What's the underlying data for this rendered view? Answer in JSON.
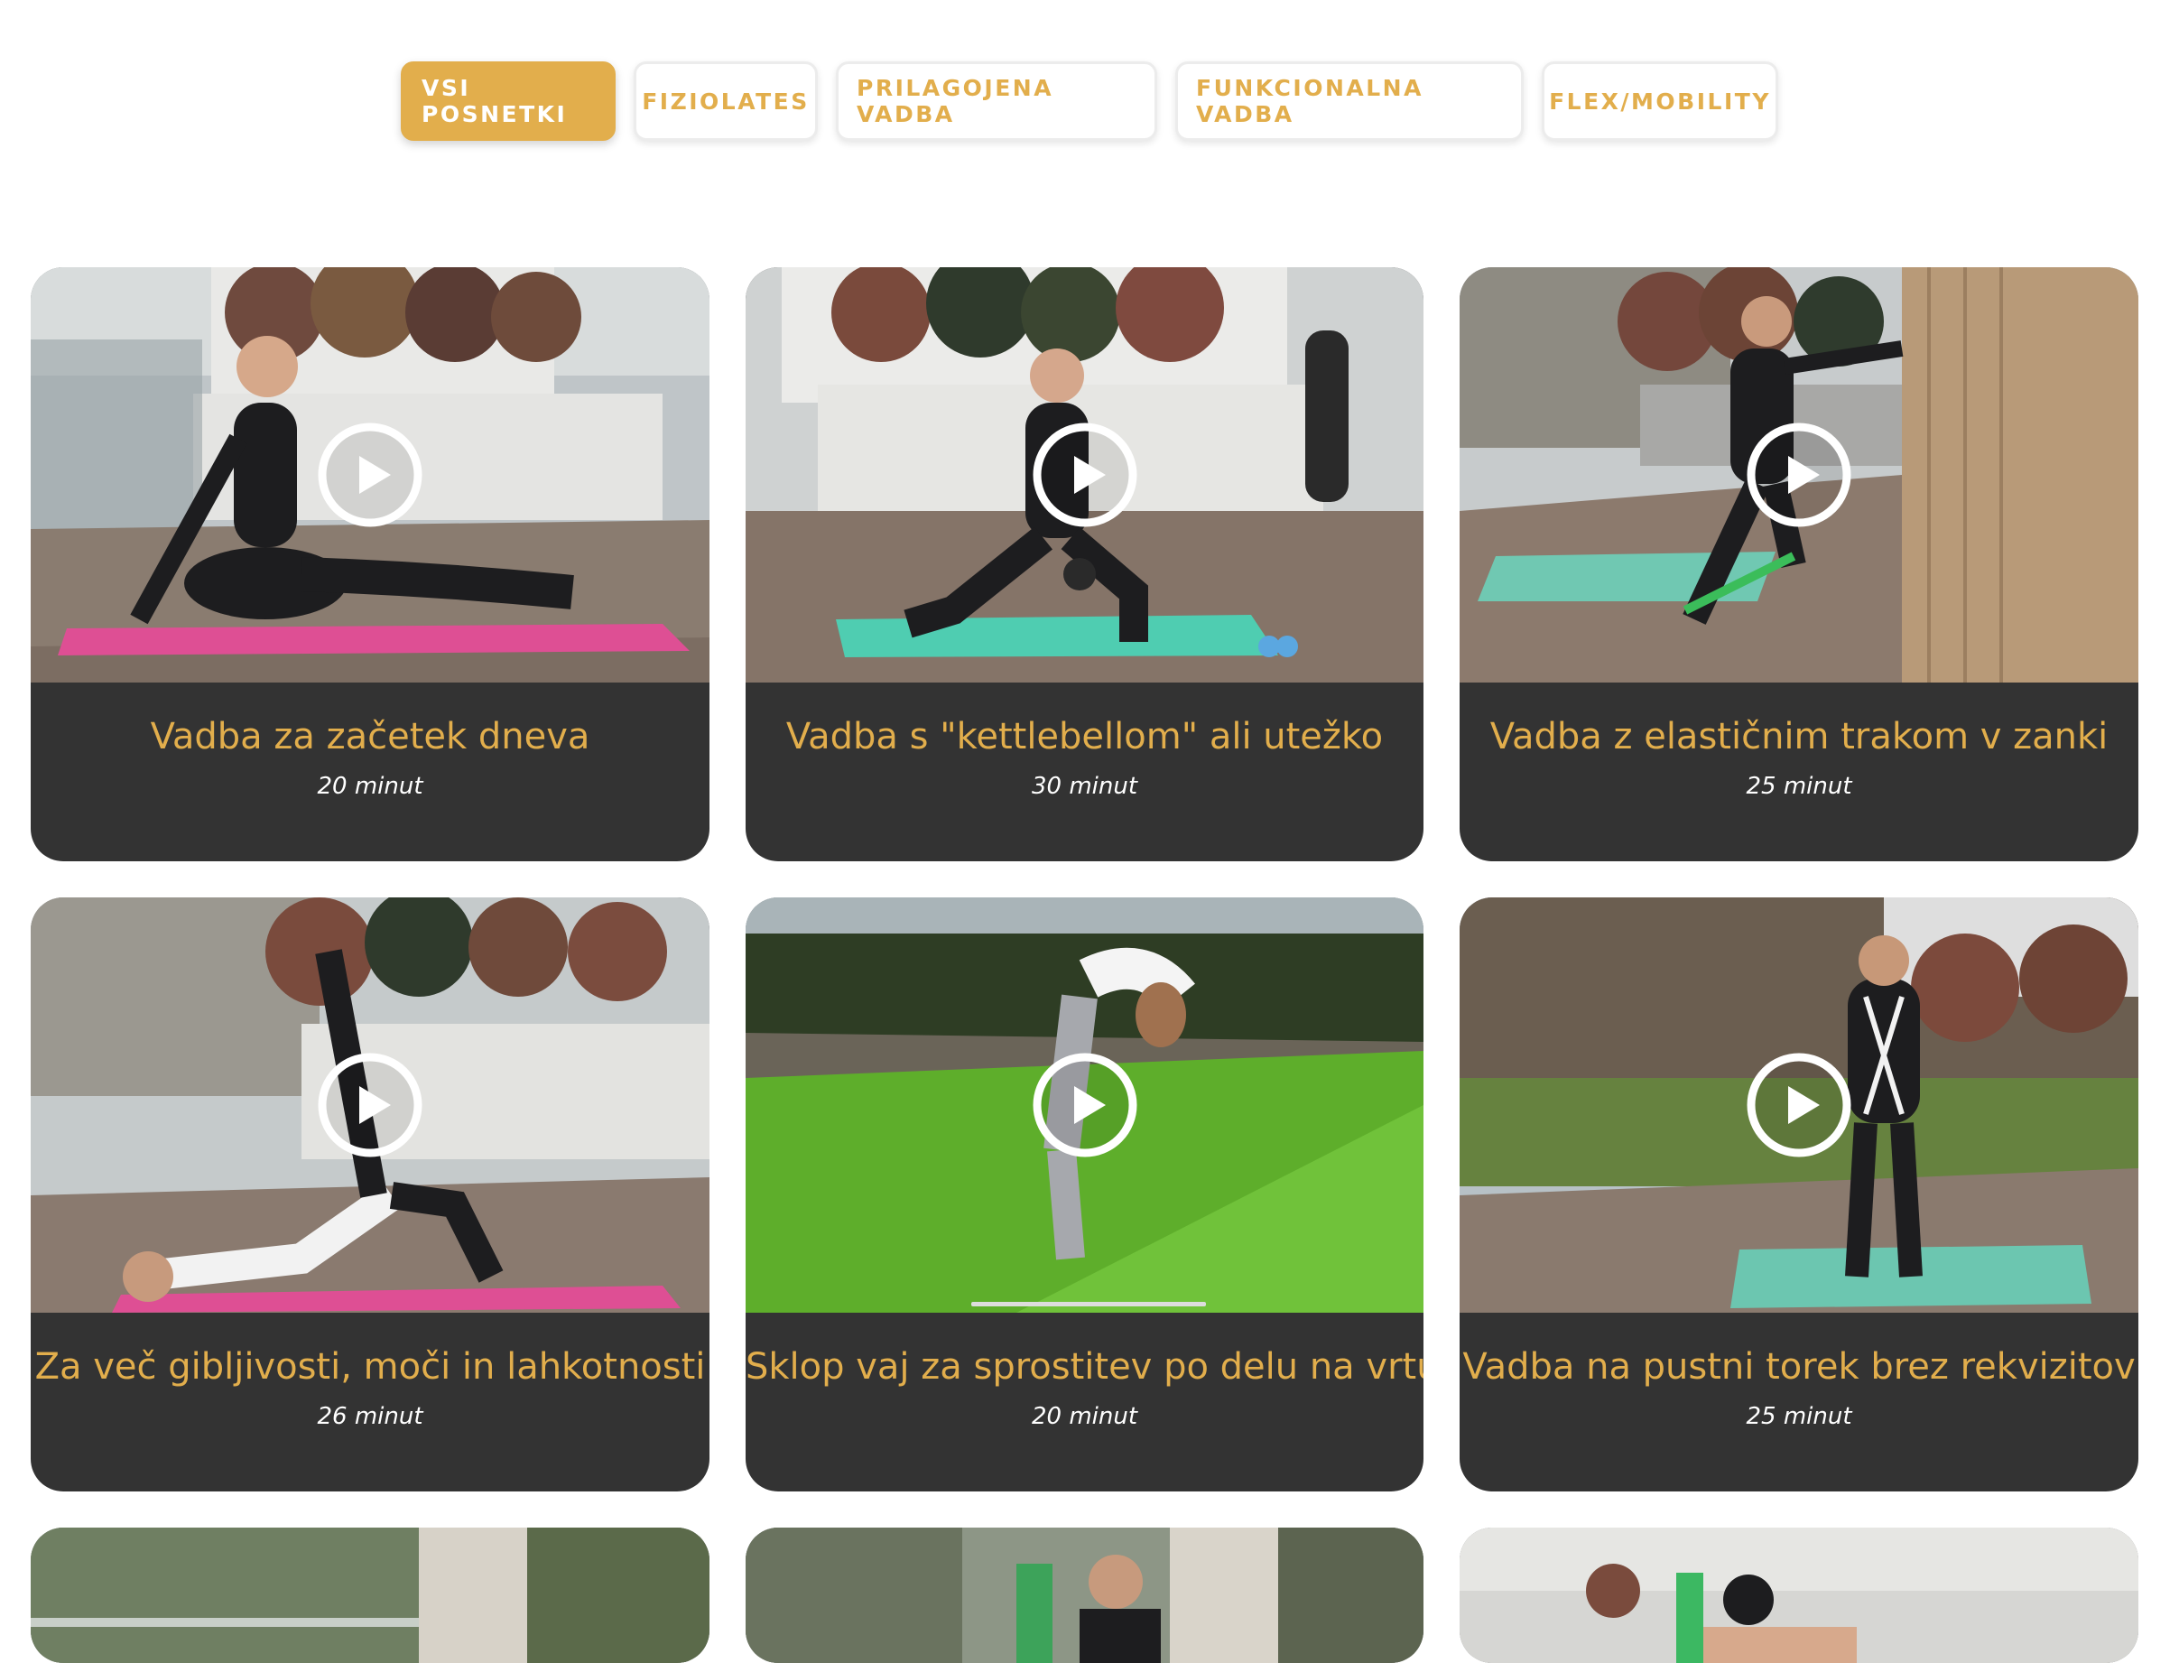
{
  "filters": [
    {
      "label": "VSI POSNETKI",
      "active": true
    },
    {
      "label": "FIZIOLATES",
      "active": false
    },
    {
      "label": "PRILAGOJENA VADBA",
      "active": false
    },
    {
      "label": "FUNKCIONALNA VADBA",
      "active": false
    },
    {
      "label": "FLEX/MOBILITY",
      "active": false
    }
  ],
  "videos": [
    {
      "title": "Vadba za začetek dneva",
      "duration": "20 minut",
      "thumb_icon": "woman-seated-twist-on-pink-mat"
    },
    {
      "title": "Vadba s \"kettlebellom\" ali utežko",
      "duration": "30 minut",
      "thumb_icon": "woman-lunge-with-kettlebell"
    },
    {
      "title": "Vadba z elastičnim trakom v zanki",
      "duration": "25 minut",
      "thumb_icon": "woman-wall-stretch-with-band"
    },
    {
      "title": "Za več gibljivosti, moči in lahkotnosti",
      "duration": "26 minut",
      "thumb_icon": "woman-bridge-leg-raise"
    },
    {
      "title": "Sklop vaj za sprostitev po delu na vrtu",
      "duration": "20 minut",
      "thumb_icon": "woman-forward-bend-on-grass"
    },
    {
      "title": "Vadba na pustni torek brez rekvizitov",
      "duration": "25 minut",
      "thumb_icon": "woman-skeleton-costume-standing"
    }
  ],
  "colors": {
    "accent": "#e2ae4c",
    "card_background": "#333333",
    "page_background": "#ffffff"
  }
}
